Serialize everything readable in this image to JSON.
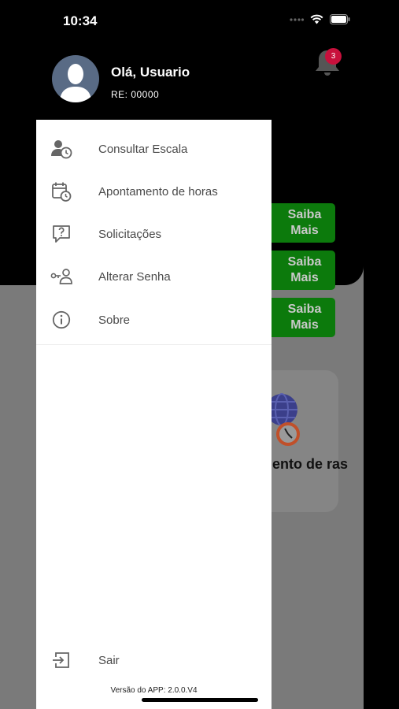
{
  "status_bar": {
    "time": "10:34"
  },
  "header": {
    "greeting": "Olá, Usuario",
    "re": "RE: 00000",
    "notification_count": "3"
  },
  "background": {
    "saiba_buttons": [
      "Saiba Mais",
      "Saiba Mais",
      "Saiba Mais"
    ],
    "card_title": "mento de ras"
  },
  "drawer": {
    "items": [
      {
        "label": "Consultar Escala",
        "icon": "user-clock-icon"
      },
      {
        "label": "Apontamento de horas",
        "icon": "calendar-clock-icon"
      },
      {
        "label": "Solicitações",
        "icon": "question-message-icon"
      },
      {
        "label": "Alterar Senha",
        "icon": "user-key-icon"
      },
      {
        "label": "Sobre",
        "icon": "info-icon"
      }
    ],
    "logout": {
      "label": "Sair",
      "icon": "logout-icon"
    },
    "version": "Versão do APP: 2.0.0.V4"
  },
  "colors": {
    "drawer_bg": "#ffffff",
    "accent_green": "#0c7a0c",
    "badge": "#c8103c"
  }
}
